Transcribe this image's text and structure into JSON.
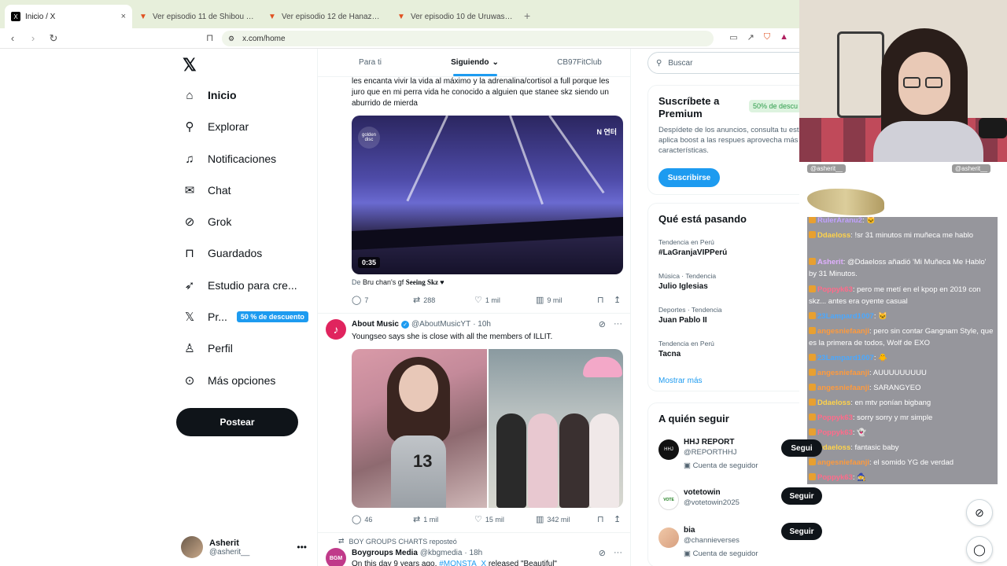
{
  "browser": {
    "tabs": [
      {
        "title": "Inicio / X",
        "icon": "x-logo-icon"
      },
      {
        "title": "Ver episodio 11 de Shibou Yuugi de",
        "icon": "flame-icon"
      },
      {
        "title": "Ver episodio 12 de Hanazakari no Ki",
        "icon": "flame-icon"
      },
      {
        "title": "Ver episodio 10 de Uruwashi no Yoi r",
        "icon": "flame-icon"
      }
    ],
    "url": "x.com/home"
  },
  "sidebar": {
    "items": [
      {
        "label": "Inicio",
        "icon": "home-icon",
        "glyph": "⌂"
      },
      {
        "label": "Explorar",
        "icon": "search-icon",
        "glyph": "⚲"
      },
      {
        "label": "Notificaciones",
        "icon": "bell-icon",
        "glyph": "🔔"
      },
      {
        "label": "Chat",
        "icon": "mail-icon",
        "glyph": "✉"
      },
      {
        "label": "Grok",
        "icon": "grok-icon",
        "glyph": "⊘"
      },
      {
        "label": "Guardados",
        "icon": "bookmark-icon",
        "glyph": "⊓"
      },
      {
        "label": "Estudio para cre...",
        "icon": "rocket-icon",
        "glyph": "➶"
      },
      {
        "label": "Pr...",
        "icon": "x-premium-icon",
        "glyph": "𝕏",
        "badge": "50 % de descuento"
      },
      {
        "label": "Perfil",
        "icon": "person-icon",
        "glyph": "♙"
      },
      {
        "label": "Más opciones",
        "icon": "more-circle-icon",
        "glyph": "⋯"
      }
    ],
    "post_button": "Postear",
    "account": {
      "name": "Asherit",
      "handle": "@asherit__"
    }
  },
  "timeline": {
    "tabs": [
      "Para ti",
      "Siguiendo",
      "CB97FitClub"
    ],
    "post1": {
      "text": "les encanta vivir la vida al máximo y la adrenalina/cortisol a full porque les juro que en mi perra vida he conocido a alguien que stanee skz siendo un aburrido de mierda",
      "video_duration": "0:35",
      "video_logo": "golden disc",
      "video_channel": "N 연터",
      "caption_prefix": "De",
      "caption_source": "Bru chan's gf",
      "caption_title": "Seeing Skz ♥",
      "replies": "7",
      "reposts": "288",
      "likes": "1 mil",
      "views": "9 mil"
    },
    "post2": {
      "name": "About Music",
      "handle": "@AboutMusicYT",
      "time": "· 10h",
      "text": "Youngseo says she is close with all the members of ILLIT.",
      "jersey_number": "13",
      "replies": "46",
      "reposts": "1 mil",
      "likes": "15 mil",
      "views": "342 mil"
    },
    "post3": {
      "repost_note": "BOY GROUPS CHARTS reposteó",
      "name": "Boygroups Media",
      "handle": "@kbgmedia",
      "time": "· 18h",
      "avatar_text": "BGM",
      "text_prefix": "On this day 9 years ago,",
      "text_link": "#MONSTA_X",
      "text_suffix": "released \"Beautiful\""
    }
  },
  "right": {
    "search_placeholder": "Buscar",
    "premium": {
      "title": "Suscríbete a Premium",
      "discount": "50% de descu",
      "desc": "Despídete de los anuncios, consulta tu estadísticas, aplica boost a las respues aprovecha más de 20 características.",
      "button": "Suscribirse"
    },
    "trends_title": "Qué está pasando",
    "trends": [
      {
        "context": "Tendencia en Perú",
        "title": "#LaGranjaVIPPerú"
      },
      {
        "context": "Música · Tendencia",
        "title": "Julio Iglesias"
      },
      {
        "context": "Deportes · Tendencia",
        "title": "Juan Pablo II"
      },
      {
        "context": "Tendencia en Perú",
        "title": "Tacna"
      }
    ],
    "show_more": "Mostrar más",
    "follow_title": "A quién seguir",
    "follow": [
      {
        "name": "HHJ REPORT",
        "handle": "@REPORTHHJ",
        "sub": "Cuenta de seguidor",
        "button": "Segui",
        "avatar_text": "HHJ"
      },
      {
        "name": "votetowin",
        "handle": "@votetowin2025",
        "sub": "",
        "button": "Seguir",
        "avatar_text": "VOTE"
      },
      {
        "name": "bia",
        "handle": "@channieverses",
        "sub": "Cuenta de seguidor",
        "button": "Seguir",
        "avatar_text": ""
      }
    ]
  },
  "stream": {
    "tags": [
      "@asherit__",
      "@asherit__"
    ],
    "chat": [
      {
        "user": "RulerAranu2",
        "text": ": 🐱",
        "color": "#c0a0ff"
      },
      {
        "user": "Ddaeloss",
        "text": ": !sr 31 minutos mi muñeca me hablo",
        "color": "#ffd24a"
      },
      {
        "user": "Asherit",
        "text": ": @Ddaeloss añadió 'Mi Muñeca Me Hablo' by 31 Minutos.",
        "color": "#e0b0ff"
      },
      {
        "user": "Poppyk63",
        "text": ": pero me metí en el kpop en 2019 con skz... antes era oyente casual",
        "color": "#ff6b8a"
      },
      {
        "user": "23Lampard1007",
        "text": ": 🐱",
        "color": "#4aa8ff"
      },
      {
        "user": "angesniefaanji",
        "text": ": pero sin contar Gangnam Style, que es la primera de todos, Wolf de EXO",
        "color": "#ff9a3c"
      },
      {
        "user": "23Lampard1007",
        "text": ": 🐥",
        "color": "#4aa8ff"
      },
      {
        "user": "angesniefaanji",
        "text": ": AUUUUUUUUU",
        "color": "#ff9a3c"
      },
      {
        "user": "angesniefaanji",
        "text": ": SARANGYEO",
        "color": "#ff9a3c"
      },
      {
        "user": "Ddaeloss",
        "text": ": en mtv ponían bigbang",
        "color": "#ffd24a"
      },
      {
        "user": "Poppyk63",
        "text": ": sorry sorry y mr simple",
        "color": "#ff6b8a"
      },
      {
        "user": "Poppyk63",
        "text": ": 👻",
        "color": "#ff6b8a"
      },
      {
        "user": "Ddaeloss",
        "text": ": fantasic baby",
        "color": "#ffd24a"
      },
      {
        "user": "angesniefaanji",
        "text": ": el somido YG de verdad",
        "color": "#ff9a3c"
      },
      {
        "user": "Poppyk63",
        "text": ": 🧙",
        "color": "#ff6b8a"
      }
    ]
  },
  "colors": {
    "accent": "#1d9bf0",
    "text": "#0f1419",
    "muted": "#536471"
  }
}
